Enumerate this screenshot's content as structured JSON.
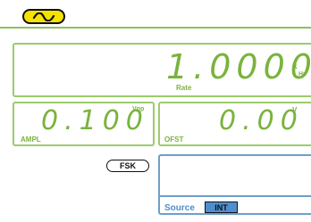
{
  "waveform": {
    "icon": "sine-wave-icon",
    "color": "#f5e200"
  },
  "frequency": {
    "value": "1.0000",
    "unit_prefix": "k",
    "unit": "Hz",
    "label": "Rate"
  },
  "amplitude": {
    "value": "0.100",
    "unit": "Vpp",
    "label": "AMPL"
  },
  "offset": {
    "value": "0.00",
    "unit": "V",
    "label": "OFST"
  },
  "fsk": {
    "label": "FSK"
  },
  "source": {
    "label": "Source",
    "value": "INT"
  },
  "colors": {
    "segment": "#7ab33c",
    "panel_border": "#9ccb6b",
    "source_border": "#6d9fc9",
    "int_bg": "#4f8fd0"
  }
}
